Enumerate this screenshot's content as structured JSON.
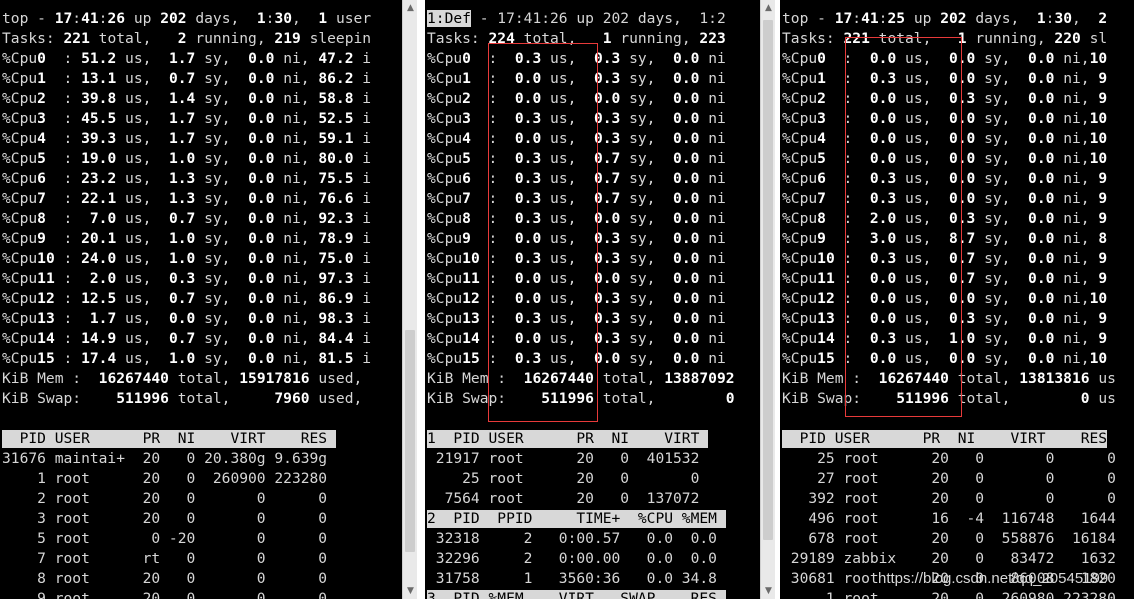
{
  "pane1": {
    "header": [
      "top - 17:41:26 up 202 days,  1:30,  1 user",
      "Tasks: 221 total,   2 running, 219 sleepin",
      "%Cpu0  : 51.2 us,  1.7 sy,  0.0 ni, 47.2 i",
      "%Cpu1  : 13.1 us,  0.7 sy,  0.0 ni, 86.2 i",
      "%Cpu2  : 39.8 us,  1.4 sy,  0.0 ni, 58.8 i",
      "%Cpu3  : 45.5 us,  1.7 sy,  0.0 ni, 52.5 i",
      "%Cpu4  : 39.3 us,  1.7 sy,  0.0 ni, 59.1 i",
      "%Cpu5  : 19.0 us,  1.0 sy,  0.0 ni, 80.0 i",
      "%Cpu6  : 23.2 us,  1.3 sy,  0.0 ni, 75.5 i",
      "%Cpu7  : 22.1 us,  1.3 sy,  0.0 ni, 76.6 i",
      "%Cpu8  :  7.0 us,  0.7 sy,  0.0 ni, 92.3 i",
      "%Cpu9  : 20.1 us,  1.0 sy,  0.0 ni, 78.9 i",
      "%Cpu10 : 24.0 us,  1.0 sy,  0.0 ni, 75.0 i",
      "%Cpu11 :  2.0 us,  0.3 sy,  0.0 ni, 97.3 i",
      "%Cpu12 : 12.5 us,  0.7 sy,  0.0 ni, 86.9 i",
      "%Cpu13 :  1.7 us,  0.0 sy,  0.0 ni, 98.3 i",
      "%Cpu14 : 14.9 us,  0.7 sy,  0.0 ni, 84.4 i",
      "%Cpu15 : 17.4 us,  1.0 sy,  0.0 ni, 81.5 i",
      "KiB Mem :  16267440 total, 15917816 used,",
      "KiB Swap:    511996 total,     7960 used,"
    ],
    "col_header": "  PID USER      PR  NI    VIRT    RES ",
    "rows": [
      "31676 maintai+  20   0 20.380g 9.639g",
      "    1 root      20   0  260900 223280",
      "    2 root      20   0       0      0",
      "    3 root      20   0       0      0",
      "    5 root       0 -20       0      0",
      "    7 root      rt   0       0      0",
      "    8 root      20   0       0      0",
      "    9 root      20   0       0      0"
    ]
  },
  "pane2": {
    "first_highlight": "1:Def",
    "first_rest": " - 17:41:26 up 202 days,  1:2",
    "header": [
      "Tasks: 224 total,   1 running, 223",
      "%Cpu0  :  0.3 us,  0.3 sy,  0.0 ni",
      "%Cpu1  :  0.0 us,  0.3 sy,  0.0 ni",
      "%Cpu2  :  0.0 us,  0.0 sy,  0.0 ni",
      "%Cpu3  :  0.3 us,  0.3 sy,  0.0 ni",
      "%Cpu4  :  0.0 us,  0.3 sy,  0.0 ni",
      "%Cpu5  :  0.3 us,  0.7 sy,  0.0 ni",
      "%Cpu6  :  0.3 us,  0.7 sy,  0.0 ni",
      "%Cpu7  :  0.3 us,  0.7 sy,  0.0 ni",
      "%Cpu8  :  0.3 us,  0.0 sy,  0.0 ni",
      "%Cpu9  :  0.0 us,  0.3 sy,  0.0 ni",
      "%Cpu10 :  0.3 us,  0.3 sy,  0.0 ni",
      "%Cpu11 :  0.0 us,  0.0 sy,  0.0 ni",
      "%Cpu12 :  0.0 us,  0.3 sy,  0.0 ni",
      "%Cpu13 :  0.3 us,  0.3 sy,  0.0 ni",
      "%Cpu14 :  0.0 us,  0.3 sy,  0.0 ni",
      "%Cpu15 :  0.3 us,  0.0 sy,  0.0 ni",
      "KiB Mem :  16267440 total, 13887092",
      "KiB Swap:    511996 total,        0"
    ],
    "win1_header": "1  PID USER      PR  NI    VIRT ",
    "win1_rows": [
      " 21917 root      20   0  401532",
      "    25 root      20   0       0",
      "  7564 root      20   0  137072"
    ],
    "win2_header": "2  PID  PPID     TIME+  %CPU %MEM ",
    "win2_rows": [
      " 32318     2   0:00.57   0.0  0.0",
      " 32296     2   0:00.00   0.0  0.0",
      " 31758     1   3560:36   0.0 34.8"
    ],
    "win3_header": "3  PID %MEM    VIRT   SWAP    RES "
  },
  "pane3": {
    "header": [
      "top - 17:41:25 up 202 days,  1:30,  2",
      "Tasks: 221 total,   1 running, 220 sl",
      "%Cpu0  :  0.0 us,  0.0 sy,  0.0 ni,10",
      "%Cpu1  :  0.3 us,  0.0 sy,  0.0 ni, 9",
      "%Cpu2  :  0.0 us,  0.3 sy,  0.0 ni, 9",
      "%Cpu3  :  0.0 us,  0.0 sy,  0.0 ni,10",
      "%Cpu4  :  0.0 us,  0.0 sy,  0.0 ni,10",
      "%Cpu5  :  0.0 us,  0.0 sy,  0.0 ni,10",
      "%Cpu6  :  0.3 us,  0.0 sy,  0.0 ni, 9",
      "%Cpu7  :  0.3 us,  0.0 sy,  0.0 ni, 9",
      "%Cpu8  :  2.0 us,  0.3 sy,  0.0 ni, 9",
      "%Cpu9  :  3.0 us,  8.7 sy,  0.0 ni, 8",
      "%Cpu10 :  0.3 us,  0.7 sy,  0.0 ni, 9",
      "%Cpu11 :  0.0 us,  0.7 sy,  0.0 ni, 9",
      "%Cpu12 :  0.0 us,  0.0 sy,  0.0 ni,10",
      "%Cpu13 :  0.0 us,  0.3 sy,  0.0 ni, 9",
      "%Cpu14 :  0.3 us,  1.0 sy,  0.0 ni, 9",
      "%Cpu15 :  0.0 us,  0.0 sy,  0.0 ni,10",
      "KiB Mem :  16267440 total, 13813816 us",
      "KiB Swap:    511996 total,        0 us"
    ],
    "col_header": "  PID USER      PR  NI    VIRT    RES",
    "rows": [
      "    25 root      20   0       0      0",
      "    27 root      20   0       0      0",
      "   392 root      20   0       0      0",
      "   496 root      16  -4  116748   1644",
      "   678 root      20   0  558876  16184",
      " 29189 zabbix    20   0   83472   1632",
      " 30681 root      20   0   86008   1820",
      "     1 root      20   0  260980 223280"
    ]
  },
  "watermark": "https://blog.csdn.net/qq_20545199",
  "colors": {
    "terminal_bg": "#000000",
    "terminal_fg": "#d6d6d6",
    "bold_fg": "#ffffff",
    "header_bar": "#d8d8d8",
    "annotation_box": "#e83a3a"
  }
}
